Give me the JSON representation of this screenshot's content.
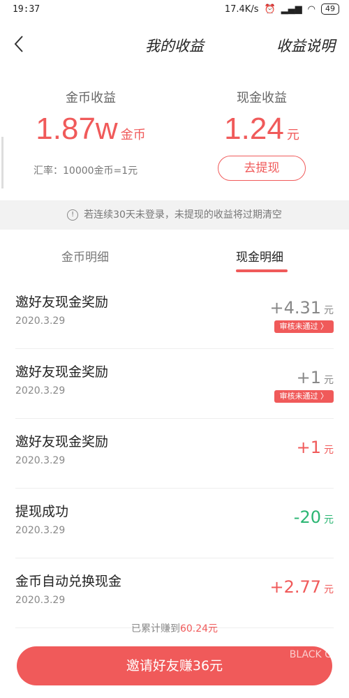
{
  "status": {
    "time": "19:37",
    "speed": "17.4K/s",
    "battery": "49"
  },
  "nav": {
    "title": "我的收益",
    "help": "收益说明"
  },
  "summary": {
    "coin": {
      "label": "金币收益",
      "amount": "1.87w",
      "unit": "金币"
    },
    "cash": {
      "label": "现金收益",
      "amount": "1.24",
      "unit": "元"
    },
    "rate": "汇率：10000金币=1元",
    "withdraw": "去提现"
  },
  "notice": "若连续30天未登录，未提现的收益将过期清空",
  "tabs": [
    {
      "label": "金币明细",
      "active": false
    },
    {
      "label": "现金明细",
      "active": true
    }
  ],
  "transactions": [
    {
      "name": "邀好友现金奖励",
      "date": "2020.3.29",
      "amount": "+4.31",
      "unit": "元",
      "badge": "审核未通过 〉"
    },
    {
      "name": "邀好友现金奖励",
      "date": "2020.3.29",
      "amount": "+1",
      "unit": "元",
      "badge": "审核未通过 〉"
    },
    {
      "name": "邀好友现金奖励",
      "date": "2020.3.29",
      "amount": "+1",
      "unit": "元",
      "badge": ""
    },
    {
      "name": "提现成功",
      "date": "2020.3.29",
      "amount": "-20",
      "unit": "元",
      "badge": ""
    },
    {
      "name": "金币自动兑换现金",
      "date": "2020.3.29",
      "amount": "+2.77",
      "unit": "元",
      "badge": ""
    }
  ],
  "footer": {
    "total_prefix": "已累计赚到",
    "total_value": "60.24元",
    "invite": "邀请好友赚36元"
  },
  "watermark": "BLACK CAT",
  "colors": {
    "accent": "#f05a5a",
    "positive_green": "#2bb673"
  }
}
